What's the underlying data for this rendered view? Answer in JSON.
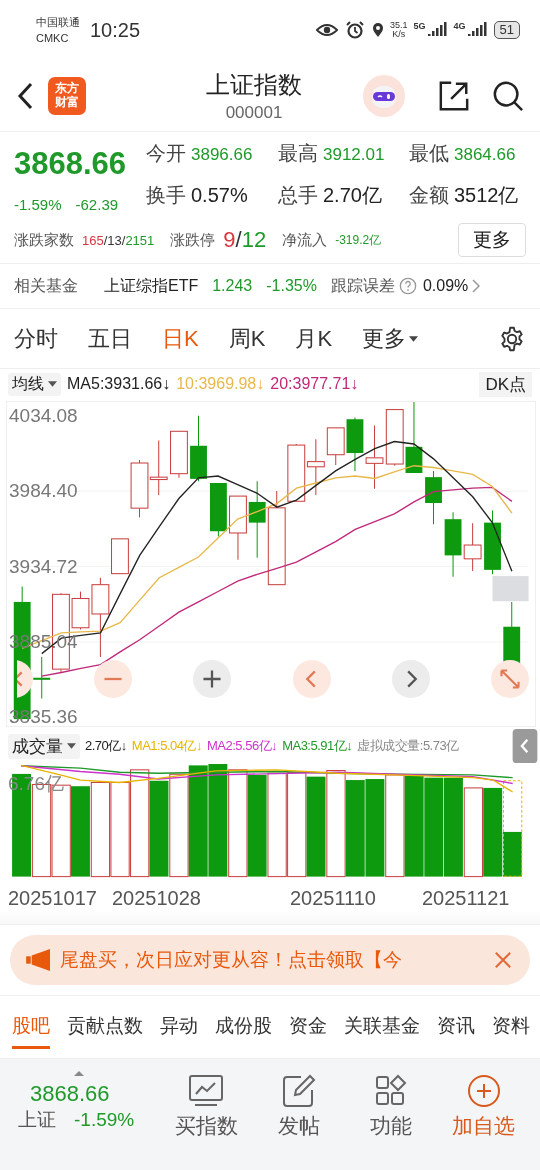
{
  "status_bar": {
    "carrier": "中国联通",
    "carrier_2": "CMKC",
    "time": "10:25",
    "net_speed": "35.1",
    "net_speed_unit": "K/s",
    "network_1": "5G",
    "network_2": "4G",
    "battery": "51"
  },
  "header": {
    "logo": [
      "东方",
      "财富"
    ],
    "title": "上证指数",
    "code": "000001"
  },
  "quote": {
    "price": "3868.66",
    "change_pct": "-1.59%",
    "change": "-62.39",
    "stats": [
      {
        "label": "今开",
        "value": "3896.66",
        "color": "#1f9a2a"
      },
      {
        "label": "最高",
        "value": "3912.01",
        "color": "#1f9a2a"
      },
      {
        "label": "最低",
        "value": "3864.66",
        "color": "#1f9a2a"
      },
      {
        "label": "换手",
        "value": "0.57%",
        "color": "#222222"
      },
      {
        "label": "总手",
        "value": "2.70亿",
        "color": "#222222"
      },
      {
        "label": "金额",
        "value": "3512亿",
        "color": "#222222"
      }
    ],
    "breadth": {
      "label": "涨跌家数",
      "parts": [
        {
          "text": "165",
          "color": "#d9363e"
        },
        {
          "text": "/13/",
          "color": "#333333"
        },
        {
          "text": "2151",
          "color": "#1f9a2a"
        }
      ]
    },
    "limit": {
      "label": "涨跌停",
      "parts": [
        {
          "text": "9",
          "color": "#d9363e"
        },
        {
          "text": "/",
          "color": "#333333"
        },
        {
          "text": "12",
          "color": "#1f9a2a"
        }
      ]
    },
    "net_inflow": {
      "label": "净流入",
      "value": "-319.2亿"
    },
    "more_button": "更多"
  },
  "related_fund": {
    "label": "相关基金",
    "name": "上证综指ETF",
    "price": "1.243",
    "change": "-1.35%",
    "error_label": "跟踪误差",
    "error_value": "0.09%"
  },
  "chart_tabs": [
    {
      "label": "分时",
      "selected": false,
      "kind": "tab"
    },
    {
      "label": "五日",
      "selected": false,
      "kind": "tab"
    },
    {
      "label": "日K",
      "selected": true,
      "kind": "tab"
    },
    {
      "label": "周K",
      "selected": false,
      "kind": "tab"
    },
    {
      "label": "月K",
      "selected": false,
      "kind": "tab"
    },
    {
      "label": "更多",
      "selected": false,
      "kind": "dropdown"
    }
  ],
  "ma_legend": {
    "selector": "均线",
    "items": [
      {
        "text": "MA5:3931.66↓",
        "color": "#222222"
      },
      {
        "text": "10:3969.98↓",
        "color": "#e8b84a"
      },
      {
        "text": "20:3977.71↓",
        "color": "#c0287a"
      }
    ],
    "dk_button": "DK点"
  },
  "price_chart": {
    "chart_data": {
      "type": "line",
      "grid": true,
      "ylim": [
        3835.36,
        4034.08
      ],
      "yticks": [
        {
          "value": 4034.08,
          "label": "4034.08"
        },
        {
          "value": 3984.4,
          "label": "3984.40"
        },
        {
          "value": 3934.72,
          "label": "3934.72"
        },
        {
          "value": 3885.04,
          "label": "3885.04"
        },
        {
          "value": 3835.36,
          "label": "3835.36"
        }
      ],
      "series": [
        {
          "color": "#222222",
          "values": [
            null,
            3877.4,
            3887.6,
            3889.4,
            3891.0,
            3916.7,
            3942.1,
            3961.0,
            3979.6,
            3993.2,
            3994.4,
            3988.7,
            3983.0,
            3973.9,
            3978.5,
            3988.2,
            3997.8,
            4005.3,
            4012.5,
            4017.1,
            4015.5,
            4005.7,
            3993.2,
            3980.7,
            3963.7,
            3931.7
          ]
        },
        {
          "color": "#e8b84a",
          "values": [
            3880.8,
            3886.0,
            3891.0,
            3891.7,
            3892.2,
            3897.8,
            3912.6,
            3927.4,
            3934.2,
            3941.0,
            3953.5,
            3966.0,
            3971.0,
            3976.2,
            3986.4,
            3989.8,
            3993.2,
            3994.4,
            3992.8,
            3997.1,
            4001.2,
            4000.0,
            3997.8,
            3995.5,
            3987.5,
            3970.0
          ]
        },
        {
          "color": "#c0287a",
          "values": [
            null,
            3862.6,
            3864.9,
            3867.6,
            3870.1,
            3878.5,
            3886.5,
            3895.6,
            3904.7,
            3911.5,
            3918.3,
            3925.1,
            3929.6,
            3933.5,
            3937.6,
            3944.4,
            3951.2,
            3959.2,
            3964.4,
            3969.4,
            3977.3,
            3984.1,
            3985.3,
            3986.4,
            3986.9,
            3977.7
          ]
        }
      ]
    }
  },
  "volume_legend": {
    "selector": "成交量",
    "items": [
      {
        "text": "2.70亿↓",
        "color": "#222222"
      },
      {
        "text": "MA1:5.04亿↓",
        "color": "#e8b400"
      },
      {
        "text": "MA2:5.56亿↓",
        "color": "#cc33cc"
      },
      {
        "text": "MA3:5.91亿↓",
        "color": "#1f9a2a"
      },
      {
        "text": "虚拟成交量:5.73亿",
        "color": "#888888"
      }
    ],
    "axis_label": "6.76亿"
  },
  "dates": [
    "20251017",
    "20251028",
    "20251110",
    "20251121"
  ],
  "banner": {
    "text": "尾盘买，次日应对更从容！点击领取【今"
  },
  "bottom_tabs": [
    {
      "label": "股吧",
      "selected": true
    },
    {
      "label": "贡献点数",
      "selected": false
    },
    {
      "label": "异动",
      "selected": false
    },
    {
      "label": "成份股",
      "selected": false
    },
    {
      "label": "资金",
      "selected": false
    },
    {
      "label": "关联基金",
      "selected": false
    },
    {
      "label": "资讯",
      "selected": false
    },
    {
      "label": "资料",
      "selected": false
    }
  ],
  "bottom_bar": {
    "price": "3868.66",
    "name": "上证",
    "change_pct": "-1.59%",
    "actions": [
      {
        "label": "买指数",
        "kind": "chart",
        "highlight": false
      },
      {
        "label": "发帖",
        "kind": "post",
        "highlight": false
      },
      {
        "label": "功能",
        "kind": "grid",
        "highlight": false
      },
      {
        "label": "加自选",
        "kind": "add",
        "highlight": true
      }
    ]
  }
}
